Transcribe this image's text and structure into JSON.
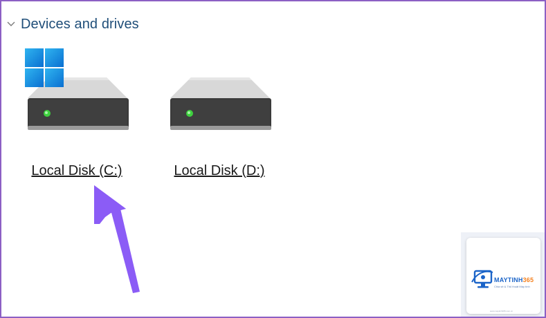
{
  "group": {
    "title": "Devices and drives",
    "expand_icon": "chevron-down-icon"
  },
  "drives": [
    {
      "label": "Local Disk (C:)",
      "icon": "hard-drive-icon",
      "system_badge": "windows-logo-icon"
    },
    {
      "label": "Local Disk (D:)",
      "icon": "hard-drive-icon"
    }
  ],
  "annotation": {
    "icon": "arrow-icon",
    "color": "#8b5cf6"
  },
  "watermark": {
    "brand_main": "MAYTINH",
    "brand_accent": "365",
    "tagline": "Chia sẻ & Thủ thuật Máy tính",
    "footer": "www.maytinh365.com.vn"
  },
  "colors": {
    "border": "#8c5fc4",
    "title": "#1f4e79",
    "drive_led": "#3fd13f"
  }
}
